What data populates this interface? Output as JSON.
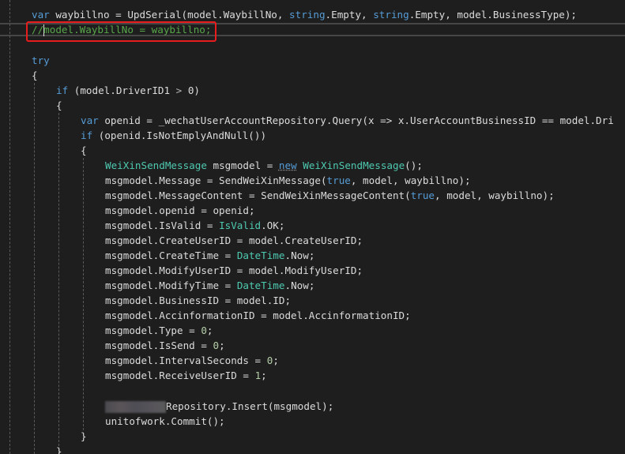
{
  "editor": {
    "theme": "dark",
    "colors": {
      "background": "#1e1e1e",
      "keyword": "#569cd6",
      "type": "#4ec9b0",
      "comment": "#57a64a",
      "number": "#b5cea8",
      "text": "#dcdcdc",
      "highlight_box": "#e81c1c"
    },
    "highlighted_line": "//model.WaybillNo = waybillno;",
    "lines": [
      {
        "tokens": [
          {
            "c": "kw",
            "t": "var"
          },
          {
            "c": "pl",
            "t": " waybillno = UpdSerial(model.WaybillNo, "
          },
          {
            "c": "kw",
            "t": "string"
          },
          {
            "c": "pl",
            "t": ".Empty, "
          },
          {
            "c": "kw",
            "t": "string"
          },
          {
            "c": "pl",
            "t": ".Empty, model.BusinessType);"
          }
        ]
      },
      {
        "tokens": [
          {
            "c": "cm",
            "t": "//"
          },
          {
            "c": "caret",
            "t": ""
          },
          {
            "c": "cm",
            "t": "model.WaybillNo = waybillno;"
          }
        ]
      },
      {
        "tokens": []
      },
      {
        "tokens": [
          {
            "c": "kw",
            "t": "try"
          }
        ]
      },
      {
        "tokens": [
          {
            "c": "pl",
            "t": "{"
          }
        ]
      },
      {
        "tokens": [
          {
            "c": "kw",
            "t": "if"
          },
          {
            "c": "pl",
            "t": " (model.DriverID1 "
          },
          {
            "c": "op",
            "t": ">"
          },
          {
            "c": "pl",
            "t": " 0)"
          }
        ]
      },
      {
        "tokens": [
          {
            "c": "pl",
            "t": "{"
          }
        ]
      },
      {
        "tokens": [
          {
            "c": "kw",
            "t": "var"
          },
          {
            "c": "pl",
            "t": " openid = _wechatUserAccountRepository.Query(x => x.UserAccountBusinessID == model.Dri"
          }
        ]
      },
      {
        "tokens": [
          {
            "c": "kw",
            "t": "if"
          },
          {
            "c": "pl",
            "t": " (openid.IsNotEmplyAndNull())"
          }
        ]
      },
      {
        "tokens": [
          {
            "c": "pl",
            "t": "{"
          }
        ]
      },
      {
        "tokens": [
          {
            "c": "ty",
            "t": "WeiXinSendMessage"
          },
          {
            "c": "pl",
            "t": " msgmodel = "
          },
          {
            "c": "kw new-kw",
            "t": "new"
          },
          {
            "c": "pl",
            "t": " "
          },
          {
            "c": "ty",
            "t": "WeiXinSendMessage"
          },
          {
            "c": "pl",
            "t": "();"
          }
        ]
      },
      {
        "tokens": [
          {
            "c": "pl",
            "t": "msgmodel.Message = SendWeiXinMessage("
          },
          {
            "c": "kw",
            "t": "true"
          },
          {
            "c": "pl",
            "t": ", model, waybillno);"
          }
        ]
      },
      {
        "tokens": [
          {
            "c": "pl",
            "t": "msgmodel.MessageContent = SendWeiXinMessageContent("
          },
          {
            "c": "kw",
            "t": "true"
          },
          {
            "c": "pl",
            "t": ", model, waybillno);"
          }
        ]
      },
      {
        "tokens": [
          {
            "c": "pl",
            "t": "msgmodel.openid = openid;"
          }
        ]
      },
      {
        "tokens": [
          {
            "c": "pl",
            "t": "msgmodel.IsValid = "
          },
          {
            "c": "ty",
            "t": "IsValid"
          },
          {
            "c": "pl",
            "t": ".OK;"
          }
        ]
      },
      {
        "tokens": [
          {
            "c": "pl",
            "t": "msgmodel.CreateUserID = model.CreateUserID;"
          }
        ]
      },
      {
        "tokens": [
          {
            "c": "pl",
            "t": "msgmodel.CreateTime = "
          },
          {
            "c": "ty",
            "t": "DateTime"
          },
          {
            "c": "pl",
            "t": ".Now;"
          }
        ]
      },
      {
        "tokens": [
          {
            "c": "pl",
            "t": "msgmodel.ModifyUserID = model.ModifyUserID;"
          }
        ]
      },
      {
        "tokens": [
          {
            "c": "pl",
            "t": "msgmodel.ModifyTime = "
          },
          {
            "c": "ty",
            "t": "DateTime"
          },
          {
            "c": "pl",
            "t": ".Now;"
          }
        ]
      },
      {
        "tokens": [
          {
            "c": "pl",
            "t": "msgmodel.BusinessID = model.ID;"
          }
        ]
      },
      {
        "tokens": [
          {
            "c": "pl",
            "t": "msgmodel.AccinformationID = model.AccinformationID;"
          }
        ]
      },
      {
        "tokens": [
          {
            "c": "pl",
            "t": "msgmodel.Type = "
          },
          {
            "c": "num",
            "t": "0"
          },
          {
            "c": "pl",
            "t": ";"
          }
        ]
      },
      {
        "tokens": [
          {
            "c": "pl",
            "t": "msgmodel.IsSend = "
          },
          {
            "c": "num",
            "t": "0"
          },
          {
            "c": "pl",
            "t": ";"
          }
        ]
      },
      {
        "tokens": [
          {
            "c": "pl",
            "t": "msgmodel.IntervalSeconds = "
          },
          {
            "c": "num",
            "t": "0"
          },
          {
            "c": "pl",
            "t": ";"
          }
        ]
      },
      {
        "tokens": [
          {
            "c": "pl",
            "t": "msgmodel.ReceiveUserID = "
          },
          {
            "c": "num",
            "t": "1"
          },
          {
            "c": "pl",
            "t": ";"
          }
        ]
      },
      {
        "tokens": []
      },
      {
        "tokens": [
          {
            "c": "blur",
            "t": ""
          },
          {
            "c": "pl",
            "t": "Repository.Insert(msgmodel);"
          }
        ]
      },
      {
        "tokens": [
          {
            "c": "pl",
            "t": "unitofwork.Commit();"
          }
        ]
      },
      {
        "tokens": [
          {
            "c": "pl",
            "t": "}"
          }
        ]
      },
      {
        "tokens": [
          {
            "c": "pl",
            "t": "}"
          }
        ]
      }
    ]
  }
}
